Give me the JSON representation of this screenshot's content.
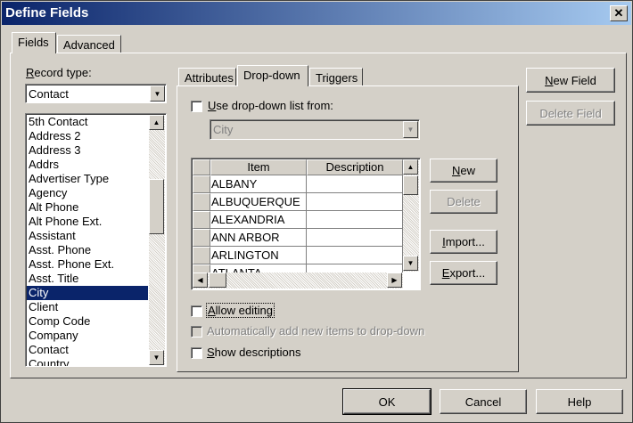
{
  "window": {
    "title": "Define Fields",
    "close_glyph": "✕"
  },
  "main_tabs": [
    {
      "label": "Fields"
    },
    {
      "label": "Advanced"
    }
  ],
  "record_type": {
    "label": "Record type:",
    "value": "Contact"
  },
  "field_list": {
    "items": [
      "5th Contact",
      "Address 2",
      "Address 3",
      "Addrs",
      "Advertiser Type",
      "Agency",
      "Alt Phone",
      "Alt Phone Ext.",
      "Assistant",
      "Asst. Phone",
      "Asst. Phone Ext.",
      "Asst. Title",
      "City",
      "Client",
      "Comp Code",
      "Company",
      "Contact",
      "Country"
    ],
    "selected": "City"
  },
  "sub_tabs": [
    {
      "label": "Attributes"
    },
    {
      "label": "Drop-down"
    },
    {
      "label": "Triggers"
    }
  ],
  "dropdown": {
    "use_list_label": "Use drop-down list from:",
    "use_list_checked": false,
    "source_value": "City",
    "columns": [
      "Item",
      "Description"
    ],
    "rows": [
      {
        "item": "ALBANY",
        "description": ""
      },
      {
        "item": "ALBUQUERQUE",
        "description": ""
      },
      {
        "item": "ALEXANDRIA",
        "description": ""
      },
      {
        "item": "ANN ARBOR",
        "description": ""
      },
      {
        "item": "ARLINGTON",
        "description": ""
      },
      {
        "item": "ATLANTA",
        "description": ""
      }
    ],
    "buttons": {
      "new": "New",
      "delete": "Delete",
      "import": "Import...",
      "export": "Export..."
    },
    "allow_editing_label": "Allow editing",
    "auto_add_label": "Automatically add new items to drop-down",
    "show_descriptions_label": "Show descriptions"
  },
  "side_buttons": {
    "new_field": "New Field",
    "delete_field": "Delete Field"
  },
  "footer": {
    "ok": "OK",
    "cancel": "Cancel",
    "help": "Help"
  },
  "arrows": {
    "down": "▼",
    "up": "▲",
    "left": "◀",
    "right": "▶"
  }
}
